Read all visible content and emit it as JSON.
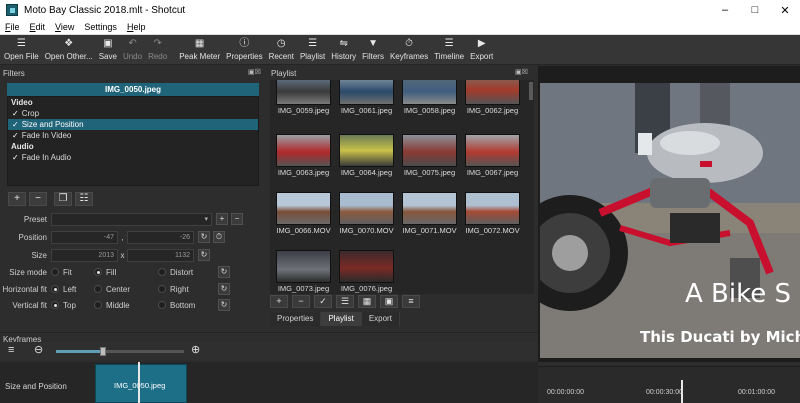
{
  "window": {
    "title": "Moto Bay Classic 2018.mlt - Shotcut"
  },
  "menu": [
    {
      "u": "F",
      "rest": "ile"
    },
    {
      "u": "E",
      "rest": "dit"
    },
    {
      "u": "V",
      "rest": "iew"
    },
    {
      "u": "",
      "rest": "Settings"
    },
    {
      "u": "H",
      "rest": "elp"
    }
  ],
  "toolbar": {
    "open_file": "Open File",
    "open_other": "Open Other...",
    "save": "Save",
    "undo": "Undo",
    "redo": "Redo",
    "peak_meter": "Peak Meter",
    "properties": "Properties",
    "recent": "Recent",
    "playlist": "Playlist",
    "history": "History",
    "filters": "Filters",
    "keyframes": "Keyframes",
    "timeline": "Timeline",
    "export": "Export"
  },
  "filters": {
    "panel_title": "Filters",
    "clip_name": "IMG_0050.jpeg",
    "video_header": "Video",
    "video_items": [
      "Crop",
      "Size and Position",
      "Fade In Video"
    ],
    "audio_header": "Audio",
    "audio_items": [
      "Fade In Audio"
    ],
    "preset_label": "Preset",
    "position_label": "Position",
    "position_x": "-47",
    "position_sep": ",",
    "position_y": "-26",
    "size_label": "Size",
    "size_w": "2013",
    "size_sep": "x",
    "size_h": "1132",
    "size_mode_label": "Size mode",
    "size_mode_opts": [
      "Fit",
      "Fill",
      "Distort"
    ],
    "h_fit_label": "Horizontal fit",
    "h_fit_opts": [
      "Left",
      "Center",
      "Right"
    ],
    "v_fit_label": "Vertical fit",
    "v_fit_opts": [
      "Top",
      "Middle",
      "Bottom"
    ]
  },
  "playlist": {
    "panel_title": "Playlist",
    "items": [
      "IMG_0059.jpeg",
      "IMG_0061.jpeg",
      "IMG_0058.jpeg",
      "IMG_0062.jpeg",
      "IMG_0063.jpeg",
      "IMG_0064.jpeg",
      "IMG_0075.jpeg",
      "IMG_0067.jpeg",
      "IMG_0066.MOV",
      "IMG_0070.MOV",
      "IMG_0071.MOV",
      "IMG_0072.MOV",
      "IMG_0073.jpeg",
      "IMG_0076.jpeg"
    ]
  },
  "tabs": [
    "Properties",
    "Playlist",
    "Export"
  ],
  "preview": {
    "title_text": "A Bike S",
    "sub_text": "This Ducati by Micha"
  },
  "keyframes": {
    "panel_title": "Keyframes",
    "track_label": "Size and Position",
    "clip_label": "IMG_0050.jpeg"
  },
  "timeline": {
    "timecodes": [
      "00:00:00:00",
      "00:00:30:00",
      "00:01:00:00"
    ]
  }
}
